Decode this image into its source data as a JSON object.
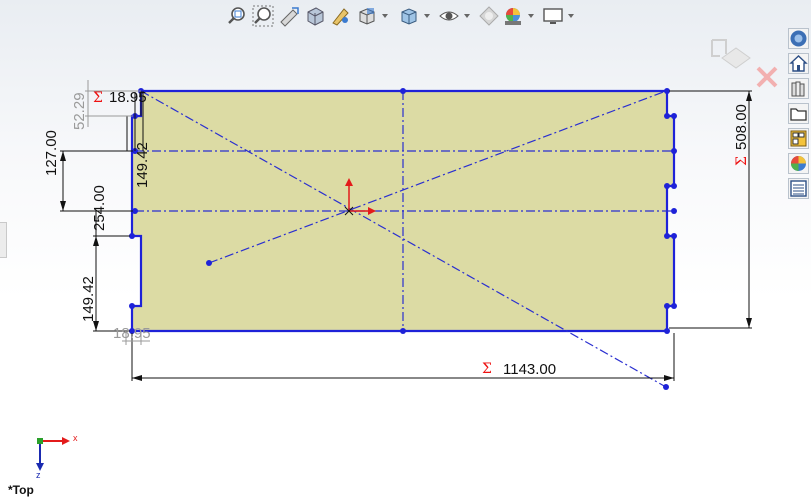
{
  "toolbar": {
    "buttons": [
      {
        "name": "zoom-to-fit",
        "icon": "zoom-to-fit-icon"
      },
      {
        "name": "zoom-to-area",
        "icon": "zoom-to-area-icon"
      },
      {
        "name": "previous-view",
        "icon": "previous-view-icon"
      },
      {
        "name": "section-view",
        "icon": "section-view-icon"
      },
      {
        "name": "dynamic-annotation-views",
        "icon": "annotation-view-icon"
      },
      {
        "name": "view-orientation",
        "icon": "view-orientation-icon"
      },
      {
        "name": "display-style",
        "icon": "display-style-icon"
      },
      {
        "name": "hide-show-items",
        "icon": "eye-icon"
      },
      {
        "name": "edit-appearance",
        "icon": "appearance-icon"
      },
      {
        "name": "apply-scene",
        "icon": "scene-icon"
      },
      {
        "name": "view-settings",
        "icon": "monitor-icon"
      }
    ]
  },
  "task_pane": {
    "items": [
      {
        "name": "solidworks-resources",
        "icon": "solidworks-resources-icon"
      },
      {
        "name": "design-library",
        "icon": "home-icon"
      },
      {
        "name": "file-explorer",
        "icon": "folder-icon"
      },
      {
        "name": "view-palette",
        "icon": "view-palette-icon"
      },
      {
        "name": "appearances-scenes",
        "icon": "color-sphere-icon"
      },
      {
        "name": "custom-properties",
        "icon": "properties-list-icon"
      }
    ]
  },
  "sketch": {
    "plate_fill": "#dcdba4",
    "line_color": "#1e22d8",
    "origin_color": "#e31b1b",
    "dimensions": {
      "overall_width": "1143.00",
      "overall_height": "508.00",
      "d_127": "127.00",
      "d_254": "254.00",
      "d_149_lower": "149.42",
      "d_149_upper": "149.42",
      "d_52": "52.29",
      "d_18_top": "18.95",
      "d_18_bottom": "18.95"
    },
    "sigma_symbol": "Σ"
  },
  "triad": {
    "x_label": "x",
    "z_label": "z"
  },
  "view_label": "*Top"
}
